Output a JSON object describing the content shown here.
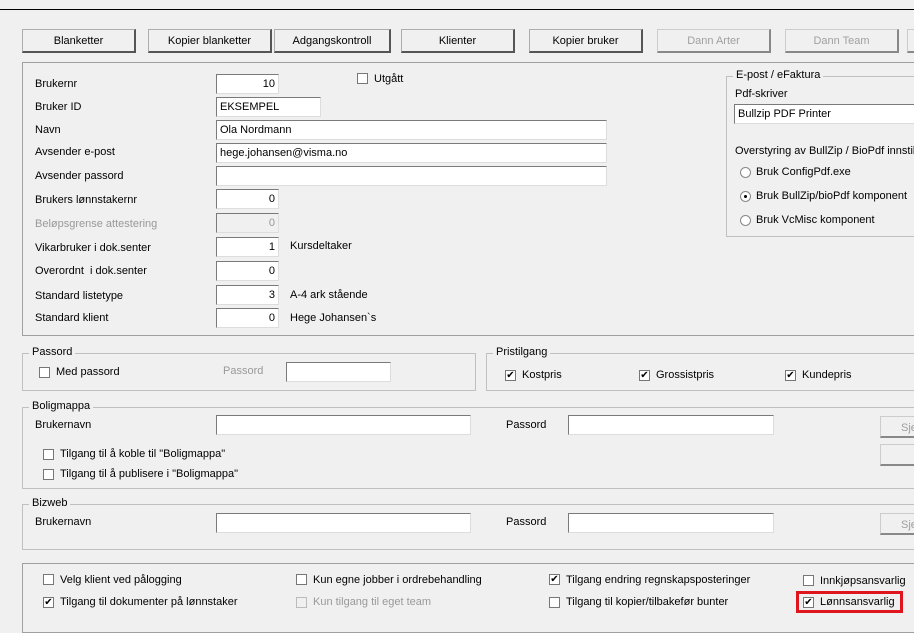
{
  "toolbar": {
    "buttons": [
      "Blanketter",
      "Kopier blanketter",
      "Adgangskontroll",
      "Klienter",
      "Kopier bruker",
      "Dann Arter",
      "Dann Team"
    ]
  },
  "user": {
    "brukernr_label": "Brukernr",
    "brukernr": "10",
    "utgatt_label": "Utgått",
    "utgatt": false,
    "brukerid_label": "Bruker ID",
    "brukerid": "EKSEMPEL",
    "navn_label": "Navn",
    "navn": "Ola Nordmann",
    "epost_label": "Avsender e-post",
    "epost": "hege.johansen@visma.no",
    "passord_label": "Avsender passord",
    "passord": "",
    "lonnstakernr_label": "Brukers lønnstakernr",
    "lonnstakernr": "0",
    "belop_label": "Beløpsgrense attestering",
    "belop": "0",
    "vikar_label": "Vikarbruker i dok.senter",
    "vikar": "1",
    "vikar_desc": "Kursdeltaker",
    "overordnet_label": "Overordnt  i dok.senter",
    "overordnet": "0",
    "listetype_label": "Standard listetype",
    "listetype": "3",
    "listetype_desc": "A-4 ark stående",
    "klient_label": "Standard klient",
    "klient": "0",
    "klient_desc": "Hege Johansen`s"
  },
  "epost": {
    "legend": "E-post / eFaktura",
    "pdf_label": "Pdf-skriver",
    "pdf": "Bullzip PDF Printer",
    "override_label": "Overstyring av BullZip / BioPdf innstil",
    "options": [
      "Bruk ConfigPdf.exe",
      "Bruk BullZip/bioPdf komponent",
      "Bruk VcMisc komponent"
    ],
    "selected": 1
  },
  "passord": {
    "legend": "Passord",
    "med_label": "Med passord",
    "med": false,
    "passord_label": "Passord",
    "passord": ""
  },
  "pristilgang": {
    "legend": "Pristilgang",
    "items": [
      {
        "label": "Kostpris",
        "checked": true
      },
      {
        "label": "Grossistpris",
        "checked": true
      },
      {
        "label": "Kundepris",
        "checked": true
      }
    ]
  },
  "boligmappa": {
    "legend": "Boligmappa",
    "brukernavn_label": "Brukernavn",
    "brukernavn": "",
    "passord_label": "Passord",
    "passord": "",
    "koble_label": "Tilgang til å koble til \"Boligmappa\"",
    "publisere_label": "Tilgang til å publisere i \"Boligmappa\"",
    "button": "Sje"
  },
  "bizweb": {
    "legend": "Bizweb",
    "brukernavn_label": "Brukernavn",
    "brukernavn": "",
    "passord_label": "Passord",
    "passord": "",
    "button": "Sje"
  },
  "options": [
    {
      "label": "Velg klient ved pålogging",
      "checked": false
    },
    {
      "label": "Tilgang til dokumenter på lønnstaker",
      "checked": true
    },
    {
      "label": "Kun egne jobber i ordrebehandling",
      "checked": false
    },
    {
      "label": "Kun tilgang til eget team",
      "checked": false
    },
    {
      "label": "Tilgang endring regnskapsposteringer",
      "checked": true
    },
    {
      "label": "Tilgang til kopier/tilbakefør bunter",
      "checked": false
    },
    {
      "label": "Innkjøpsansvarlig",
      "checked": false
    },
    {
      "label": "Lønnsansvarlig",
      "checked": true
    }
  ],
  "highlight_color": "#e0161f"
}
